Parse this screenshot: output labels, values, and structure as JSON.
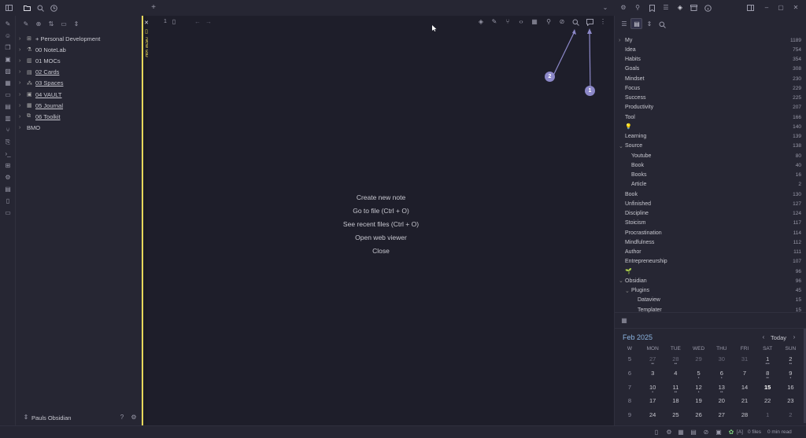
{
  "left_tree": [
    {
      "label": "+ Personal Development",
      "underline": false,
      "icon": "briefcase-icon",
      "glyph": "⊞"
    },
    {
      "label": "00 NoteLab",
      "underline": false,
      "icon": "flask-icon",
      "glyph": "⚗"
    },
    {
      "label": "01 MOCs",
      "underline": false,
      "icon": "map-icon",
      "glyph": "▥"
    },
    {
      "label": "02 Cards",
      "underline": true,
      "icon": "cards-icon",
      "glyph": "▤"
    },
    {
      "label": "03 Spaces",
      "underline": true,
      "icon": "network-icon",
      "glyph": "⁂"
    },
    {
      "label": "04 VAULT",
      "underline": true,
      "icon": "vault-icon",
      "glyph": "▣"
    },
    {
      "label": "05 Journal",
      "underline": true,
      "icon": "journal-icon",
      "glyph": "▦"
    },
    {
      "label": "06 Toolkit",
      "underline": true,
      "icon": "toolkit-icon",
      "glyph": "⧉"
    },
    {
      "label": "BMO",
      "underline": false,
      "icon": "",
      "glyph": ""
    }
  ],
  "vault_name": "Pauls Obsidian",
  "tab": {
    "label": "New tab",
    "number": "1"
  },
  "empty_actions": [
    "Create new note",
    "Go to file (Ctrl + O)",
    "See recent files (Ctrl + O)",
    "Open web viewer",
    "Close"
  ],
  "annotations": [
    "1",
    "2"
  ],
  "tags": [
    {
      "name": "My",
      "count": "1189",
      "chev": "›",
      "indent": 0
    },
    {
      "name": "Idea",
      "count": "754",
      "chev": "",
      "indent": 0
    },
    {
      "name": "Habits",
      "count": "354",
      "chev": "",
      "indent": 0
    },
    {
      "name": "Goals",
      "count": "308",
      "chev": "",
      "indent": 0
    },
    {
      "name": "Mindset",
      "count": "230",
      "chev": "",
      "indent": 0
    },
    {
      "name": "Focus",
      "count": "229",
      "chev": "",
      "indent": 0
    },
    {
      "name": "Success",
      "count": "225",
      "chev": "",
      "indent": 0
    },
    {
      "name": "Productivity",
      "count": "207",
      "chev": "",
      "indent": 0
    },
    {
      "name": "Tool",
      "count": "166",
      "chev": "",
      "indent": 0
    },
    {
      "name": "💡",
      "count": "140",
      "chev": "",
      "indent": 0
    },
    {
      "name": "Learning",
      "count": "139",
      "chev": "",
      "indent": 0
    },
    {
      "name": "Source",
      "count": "138",
      "chev": "⌄",
      "indent": 0
    },
    {
      "name": "Youtube",
      "count": "80",
      "chev": "",
      "indent": 1
    },
    {
      "name": "Book",
      "count": "40",
      "chev": "",
      "indent": 1
    },
    {
      "name": "Books",
      "count": "16",
      "chev": "",
      "indent": 1
    },
    {
      "name": "Article",
      "count": "2",
      "chev": "",
      "indent": 1
    },
    {
      "name": "Book",
      "count": "130",
      "chev": "",
      "indent": 0
    },
    {
      "name": "Unfinished",
      "count": "127",
      "chev": "",
      "indent": 0
    },
    {
      "name": "Discipline",
      "count": "124",
      "chev": "",
      "indent": 0
    },
    {
      "name": "Stoicism",
      "count": "117",
      "chev": "",
      "indent": 0
    },
    {
      "name": "Procrastination",
      "count": "114",
      "chev": "",
      "indent": 0
    },
    {
      "name": "Mindfulness",
      "count": "112",
      "chev": "",
      "indent": 0
    },
    {
      "name": "Author",
      "count": "111",
      "chev": "",
      "indent": 0
    },
    {
      "name": "Entrepreneurship",
      "count": "107",
      "chev": "",
      "indent": 0
    },
    {
      "name": "🌱",
      "count": "96",
      "chev": "",
      "indent": 0
    },
    {
      "name": "Obsidian",
      "count": "96",
      "chev": "⌄",
      "indent": 0
    },
    {
      "name": "Plugins",
      "count": "45",
      "chev": "⌄",
      "indent": 1
    },
    {
      "name": "Dataview",
      "count": "15",
      "chev": "",
      "indent": 2
    },
    {
      "name": "Templater",
      "count": "15",
      "chev": "",
      "indent": 2
    }
  ],
  "calendar": {
    "month": "Feb",
    "year": "2025",
    "today_label": "Today",
    "headers": [
      "W",
      "MON",
      "TUE",
      "WED",
      "THU",
      "FRI",
      "SAT",
      "SUN"
    ],
    "weeks": [
      {
        "w": "5",
        "days": [
          {
            "d": "27",
            "m": true,
            "dots": "••"
          },
          {
            "d": "28",
            "m": true,
            "dots": "••"
          },
          {
            "d": "29",
            "m": true,
            "dots": ""
          },
          {
            "d": "30",
            "m": true,
            "dots": ""
          },
          {
            "d": "31",
            "m": true,
            "dots": ""
          },
          {
            "d": "1",
            "m": false,
            "dots": "•••"
          },
          {
            "d": "2",
            "m": false,
            "dots": "••"
          }
        ]
      },
      {
        "w": "6",
        "days": [
          {
            "d": "3",
            "m": false,
            "dots": ""
          },
          {
            "d": "4",
            "m": false,
            "dots": ""
          },
          {
            "d": "5",
            "m": false,
            "dots": "•"
          },
          {
            "d": "6",
            "m": false,
            "dots": "•"
          },
          {
            "d": "7",
            "m": false,
            "dots": ""
          },
          {
            "d": "8",
            "m": false,
            "dots": "••"
          },
          {
            "d": "9",
            "m": false,
            "dots": "•"
          }
        ]
      },
      {
        "w": "7",
        "days": [
          {
            "d": "10",
            "m": false,
            "dots": "•"
          },
          {
            "d": "11",
            "m": false,
            "dots": "••"
          },
          {
            "d": "12",
            "m": false,
            "dots": "•"
          },
          {
            "d": "13",
            "m": false,
            "dots": "••"
          },
          {
            "d": "14",
            "m": false,
            "dots": ""
          },
          {
            "d": "15",
            "m": false,
            "dots": "",
            "today": true
          },
          {
            "d": "16",
            "m": false,
            "dots": ""
          }
        ]
      },
      {
        "w": "8",
        "days": [
          {
            "d": "17",
            "m": false,
            "dots": ""
          },
          {
            "d": "18",
            "m": false,
            "dots": ""
          },
          {
            "d": "19",
            "m": false,
            "dots": ""
          },
          {
            "d": "20",
            "m": false,
            "dots": ""
          },
          {
            "d": "21",
            "m": false,
            "dots": ""
          },
          {
            "d": "22",
            "m": false,
            "dots": ""
          },
          {
            "d": "23",
            "m": false,
            "dots": ""
          }
        ]
      },
      {
        "w": "9",
        "days": [
          {
            "d": "24",
            "m": false,
            "dots": ""
          },
          {
            "d": "25",
            "m": false,
            "dots": ""
          },
          {
            "d": "26",
            "m": false,
            "dots": ""
          },
          {
            "d": "27",
            "m": false,
            "dots": ""
          },
          {
            "d": "28",
            "m": false,
            "dots": ""
          },
          {
            "d": "1",
            "m": true,
            "dots": ""
          },
          {
            "d": "2",
            "m": true,
            "dots": ""
          }
        ]
      }
    ]
  },
  "status": {
    "mode": "[A]",
    "files": "0 files",
    "read": "0 min read"
  },
  "colors": {
    "accent": "#e8d85a",
    "badge": "#8c88c8",
    "link": "#8bb4e0"
  }
}
